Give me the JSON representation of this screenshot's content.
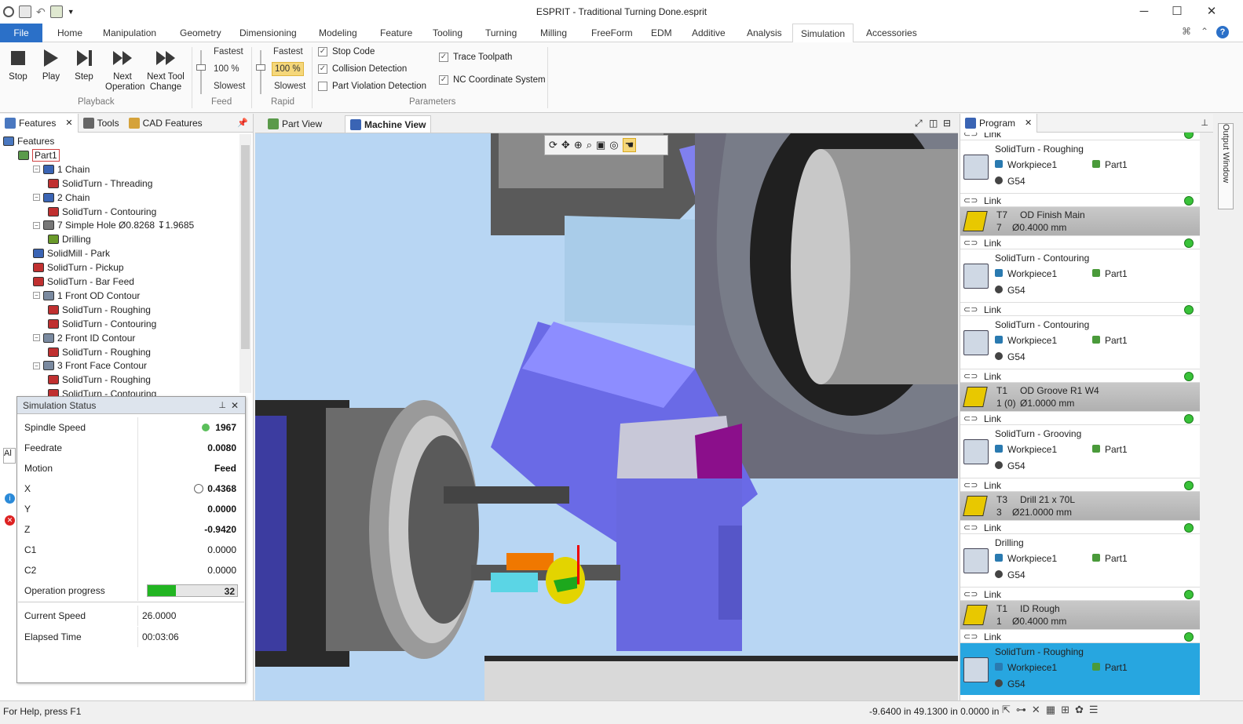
{
  "window": {
    "title": "ESPRIT - Traditional Turning Done.esprit"
  },
  "menu_tabs": [
    "File",
    "Home",
    "Manipulation",
    "Geometry",
    "Dimensioning",
    "Modeling",
    "Feature",
    "Tooling",
    "Turning",
    "Milling",
    "FreeForm",
    "EDM",
    "Additive",
    "Analysis",
    "Simulation",
    "Accessories"
  ],
  "ribbon": {
    "playback": {
      "stop": "Stop",
      "play": "Play",
      "step": "Step",
      "next_op_1": "Next",
      "next_op_2": "Operation",
      "next_tool_1": "Next Tool",
      "next_tool_2": "Change",
      "group": "Playback"
    },
    "feed": {
      "fastest": "Fastest",
      "value": "100 %",
      "slowest": "Slowest",
      "group": "Feed"
    },
    "rapid": {
      "fastest": "Fastest",
      "value": "100 %",
      "slowest": "Slowest",
      "group": "Rapid"
    },
    "params": {
      "stop_code": "Stop Code",
      "collision": "Collision Detection",
      "part_violation": "Part Violation Detection",
      "trace": "Trace Toolpath",
      "nc_coord": "NC Coordinate System",
      "group": "Parameters",
      "stop_code_checked": true,
      "collision_checked": true,
      "part_violation_checked": false,
      "trace_checked": true,
      "nc_coord_checked": true
    }
  },
  "left_tabs": {
    "features": "Features",
    "tools": "Tools",
    "cad": "CAD Features"
  },
  "tree": [
    {
      "label": "Features",
      "indent": 0,
      "icon": "features-icon"
    },
    {
      "label": "Part1",
      "indent": 1,
      "icon": "part-icon"
    },
    {
      "label": "1 Chain",
      "indent": 2,
      "icon": "chain-icon"
    },
    {
      "label": "SolidTurn - Threading",
      "indent": 3,
      "icon": "turn-op-icon"
    },
    {
      "label": "2 Chain",
      "indent": 2,
      "icon": "chain-icon"
    },
    {
      "label": "SolidTurn - Contouring",
      "indent": 3,
      "icon": "turn-op-icon"
    },
    {
      "label": "7 Simple Hole Ø0.8268 ↧1.9685",
      "indent": 2,
      "icon": "hole-icon"
    },
    {
      "label": "Drilling",
      "indent": 3,
      "icon": "drill-op-icon"
    },
    {
      "label": "SolidMill - Park",
      "indent": 2,
      "icon": "mill-op-icon"
    },
    {
      "label": "SolidTurn - Pickup",
      "indent": 2,
      "icon": "turn-op-icon"
    },
    {
      "label": "SolidTurn - Bar Feed",
      "indent": 2,
      "icon": "turn-op-icon"
    },
    {
      "label": "1 Front OD Contour",
      "indent": 2,
      "icon": "contour-icon"
    },
    {
      "label": "SolidTurn - Roughing",
      "indent": 3,
      "icon": "turn-op-icon"
    },
    {
      "label": "SolidTurn - Contouring",
      "indent": 3,
      "icon": "turn-op-icon"
    },
    {
      "label": "2 Front ID Contour",
      "indent": 2,
      "icon": "contour-icon"
    },
    {
      "label": "SolidTurn - Roughing",
      "indent": 3,
      "icon": "turn-op-icon"
    },
    {
      "label": "3 Front Face Contour",
      "indent": 2,
      "icon": "contour-icon"
    },
    {
      "label": "SolidTurn - Roughing",
      "indent": 3,
      "icon": "turn-op-icon"
    },
    {
      "label": "SolidTurn - Contouring",
      "indent": 3,
      "icon": "turn-op-icon"
    }
  ],
  "sim_status": {
    "title": "Simulation Status",
    "rows": [
      {
        "label": "Spindle Speed",
        "value": "1967",
        "bold": true
      },
      {
        "label": "Feedrate",
        "value": "0.0080",
        "bold": true
      },
      {
        "label": "Motion",
        "value": "Feed",
        "bold": true
      },
      {
        "label": "X",
        "value": "0.4368",
        "bold": true
      },
      {
        "label": "Y",
        "value": "0.0000",
        "bold": true
      },
      {
        "label": "Z",
        "value": "-0.9420",
        "bold": true
      },
      {
        "label": "C1",
        "value": "0.0000",
        "bold": false
      },
      {
        "label": "C2",
        "value": "0.0000",
        "bold": false
      }
    ],
    "progress_label": "Operation progress",
    "progress_value": "32",
    "progress_fraction": 0.32,
    "current_speed_label": "Current Speed",
    "current_speed": "26.0000",
    "elapsed_label": "Elapsed Time",
    "elapsed": "00:03:06"
  },
  "view_tabs": {
    "part": "Part View",
    "machine": "Machine View"
  },
  "program": {
    "tab": "Program",
    "items": [
      {
        "type": "link",
        "label": "Link"
      },
      {
        "type": "op",
        "name": "SolidTurn - Roughing",
        "wp": "Workpiece1",
        "part": "Part1",
        "wcs": "G54"
      },
      {
        "type": "link",
        "label": "Link"
      },
      {
        "type": "tool",
        "id": "T7",
        "name": "OD Finish Main",
        "num": "7",
        "dia": "Ø0.4000 mm"
      },
      {
        "type": "link",
        "label": "Link"
      },
      {
        "type": "op",
        "name": "SolidTurn - Contouring",
        "wp": "Workpiece1",
        "part": "Part1",
        "wcs": "G54"
      },
      {
        "type": "link",
        "label": "Link"
      },
      {
        "type": "op",
        "name": "SolidTurn - Contouring",
        "wp": "Workpiece1",
        "part": "Part1",
        "wcs": "G54"
      },
      {
        "type": "link",
        "label": "Link"
      },
      {
        "type": "tool",
        "id": "T1",
        "name": "OD Groove R1 W4",
        "num": "1 (0)",
        "dia": "Ø1.0000 mm"
      },
      {
        "type": "link",
        "label": "Link"
      },
      {
        "type": "op",
        "name": "SolidTurn - Grooving",
        "wp": "Workpiece1",
        "part": "Part1",
        "wcs": "G54"
      },
      {
        "type": "link",
        "label": "Link"
      },
      {
        "type": "tool",
        "id": "T3",
        "name": "Drill 21 x 70L",
        "num": "3",
        "dia": "Ø21.0000 mm"
      },
      {
        "type": "link",
        "label": "Link"
      },
      {
        "type": "op",
        "name": "Drilling",
        "wp": "Workpiece1",
        "part": "Part1",
        "wcs": "G54"
      },
      {
        "type": "link",
        "label": "Link"
      },
      {
        "type": "tool",
        "id": "T1",
        "name": "ID Rough",
        "num": "1",
        "dia": "Ø0.4000 mm"
      },
      {
        "type": "link",
        "label": "Link"
      },
      {
        "type": "op",
        "name": "SolidTurn - Roughing",
        "wp": "Workpiece1",
        "part": "Part1",
        "wcs": "G54",
        "selected": true
      }
    ]
  },
  "output_window": "Output Window",
  "status": {
    "help": "For Help, press F1",
    "coords": "-9.6400 in 49.1300 in 0.0000 in"
  },
  "colors": {
    "accent": "#2b70c8",
    "selected": "#27a6e0",
    "progress": "#22b522"
  }
}
